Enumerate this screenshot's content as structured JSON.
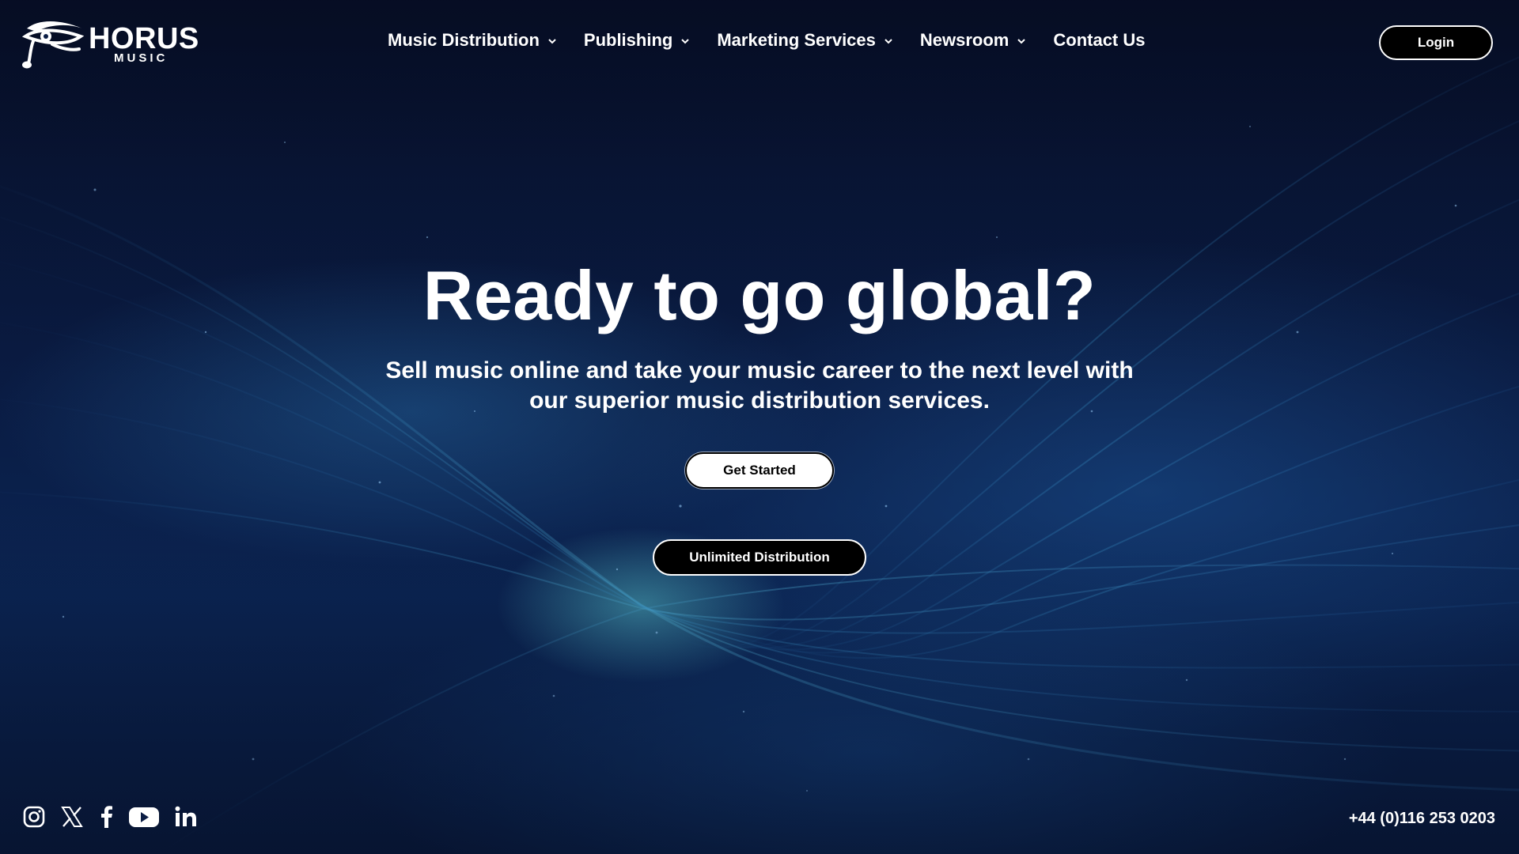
{
  "brand": {
    "name": "HORUS",
    "sub": "MUSIC"
  },
  "nav": {
    "items": [
      {
        "label": "Music Distribution",
        "has_dropdown": true
      },
      {
        "label": "Publishing",
        "has_dropdown": true
      },
      {
        "label": "Marketing Services",
        "has_dropdown": true
      },
      {
        "label": "Newsroom",
        "has_dropdown": true
      },
      {
        "label": "Contact Us",
        "has_dropdown": false
      }
    ],
    "login_label": "Login"
  },
  "hero": {
    "title": "Ready to go global?",
    "subtitle": "Sell music online and take your music career to the next level with our superior music distribution services.",
    "primary_cta": "Get Started",
    "secondary_cta": "Unlimited Distribution"
  },
  "footer": {
    "socials": [
      "instagram-icon",
      "x-twitter-icon",
      "facebook-icon",
      "youtube-icon",
      "linkedin-icon"
    ],
    "phone": "+44 (0)116 253 0203"
  },
  "colors": {
    "background": "#0a1c44",
    "accent_glow": "#5ac8d2",
    "text": "#ffffff",
    "button_dark": "#000000",
    "button_light": "#ffffff"
  }
}
